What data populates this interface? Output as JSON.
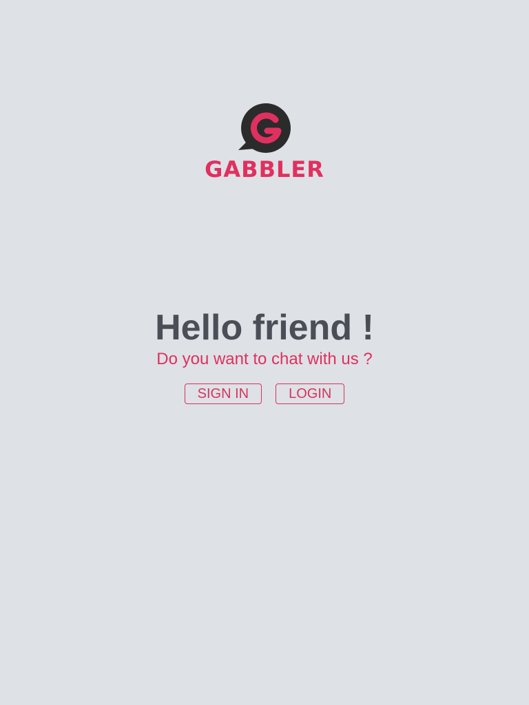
{
  "brand": {
    "name": "GABBLER",
    "logo_icon": "speech-bubble-g-icon",
    "accent_color": "#e0305f",
    "bubble_color": "#2b2b2b"
  },
  "hero": {
    "title": "Hello friend !",
    "subtitle": "Do you want to chat with us ?"
  },
  "actions": {
    "sign_in_label": "SIGN IN",
    "login_label": "LOGIN"
  },
  "colors": {
    "background": "#dee1e5",
    "title_text": "#4a4f57"
  }
}
